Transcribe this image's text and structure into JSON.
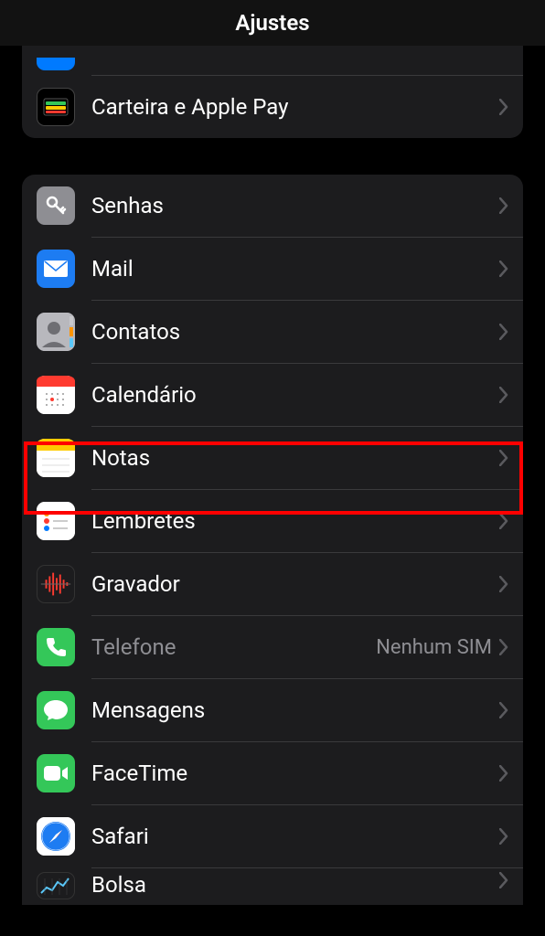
{
  "header": {
    "title": "Ajustes"
  },
  "section1": {
    "wallet": "Carteira e Apple Pay"
  },
  "section2": {
    "passwords": "Senhas",
    "mail": "Mail",
    "contacts": "Contatos",
    "calendar": "Calendário",
    "notes": "Notas",
    "reminders": "Lembretes",
    "voicememos": "Gravador",
    "phone": "Telefone",
    "phone_value": "Nenhum SIM",
    "messages": "Mensagens",
    "facetime": "FaceTime",
    "safari": "Safari",
    "stocks": "Bolsa"
  },
  "highlighted_item": "notes"
}
